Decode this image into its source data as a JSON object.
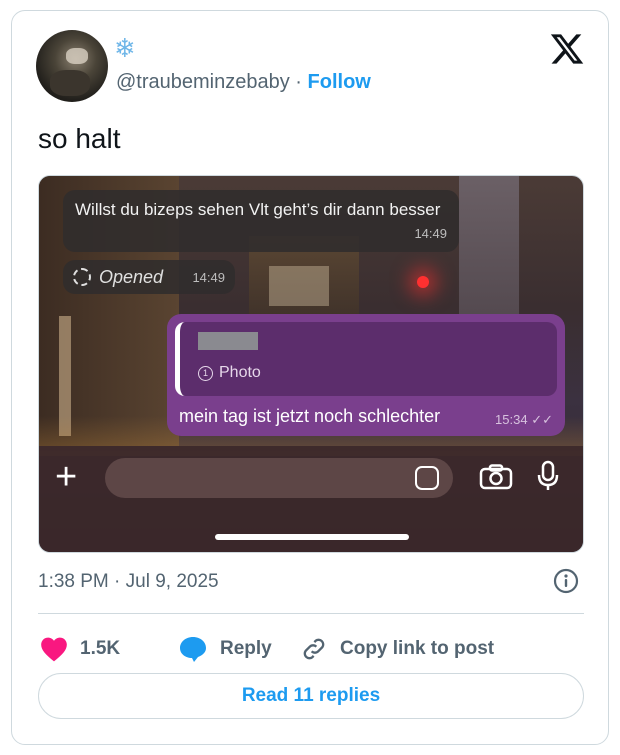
{
  "author": {
    "emoji": "❄",
    "handle": "@traubeminzebaby",
    "separator": "·",
    "follow_label": "Follow"
  },
  "tweet": {
    "text": "so halt"
  },
  "screenshot": {
    "incoming_message": "Willst du bizeps sehen Vlt geht’s dir dann besser",
    "incoming_time": "14:49",
    "opened_label": "Opened",
    "opened_time": "14:49",
    "reply_preview_label": "Photo",
    "outgoing_message": "mein tag ist jetzt noch schlechter",
    "outgoing_time": "15:34"
  },
  "meta": {
    "timestamp": "1:38 PM · Jul 9, 2025"
  },
  "actions": {
    "like_count": "1.5K",
    "reply_label": "Reply",
    "copy_label": "Copy link to post"
  },
  "read_replies_label": "Read 11 replies",
  "colors": {
    "accent": "#1d9bf0",
    "like": "#f91880",
    "chat_purple": "#7a3f8d"
  }
}
